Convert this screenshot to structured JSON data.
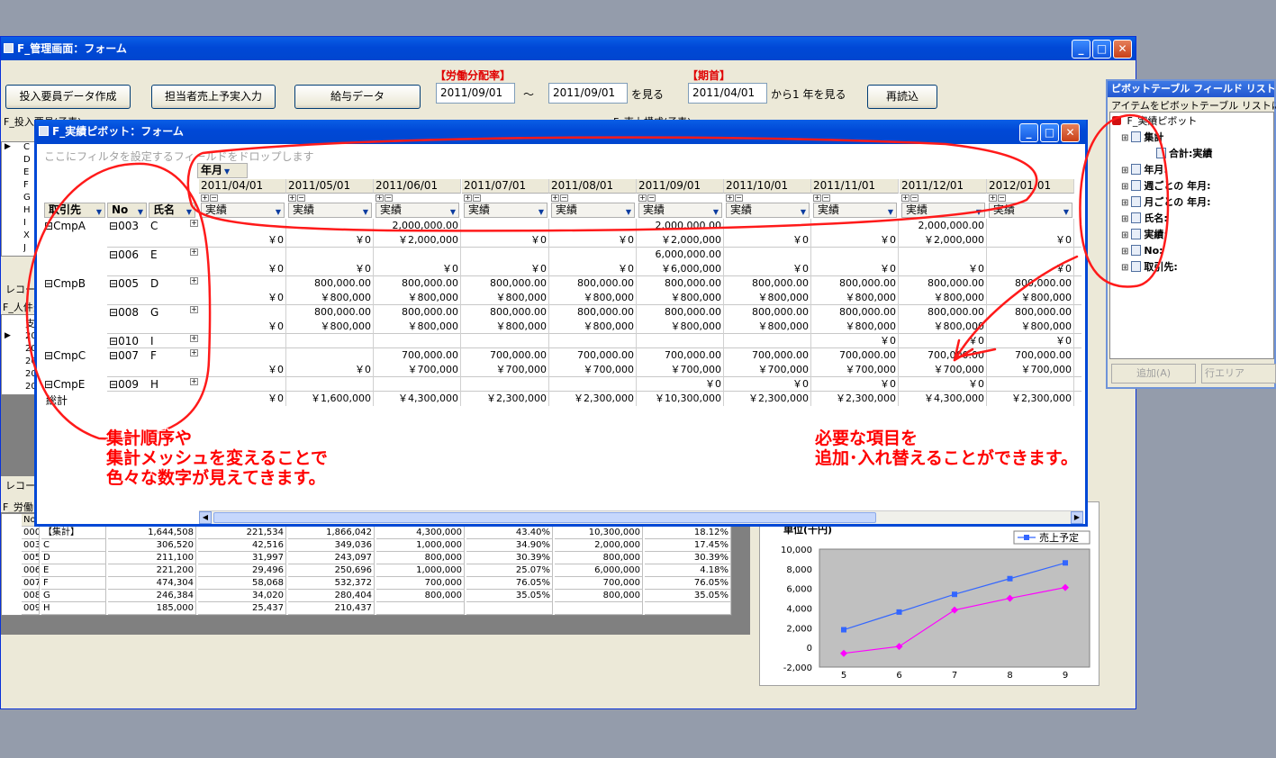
{
  "main_window": {
    "title": "F_管理画面：フォーム",
    "buttons": {
      "input_staff": "投入要員データ作成",
      "sales_plan": "担当者売上予実入力",
      "salary": "給与データ",
      "reload": "再読込"
    },
    "labor_rate_label": "【労働分配率】",
    "period_label": "【期首】",
    "date_from": "2011/09/01",
    "tilde": "～",
    "date_to": "2011/09/01",
    "view_label": "を見る",
    "period_start": "2011/04/01",
    "year_view_label": "から1 年を見る",
    "subform1_label": "F_投入要員(子表)",
    "subform2_label": "F_売上構成(子表)",
    "record_label": "レコー",
    "personnel_label": "F_人件費",
    "personnel_header": "支",
    "record_label2": "レコー",
    "labor_label": "F_労働",
    "left_rows": [
      "C",
      "D",
      "E",
      "F",
      "G",
      "H",
      "I",
      "X",
      "J"
    ],
    "personnel_rows": [
      "20",
      "20",
      "20",
      "20",
      "20"
    ]
  },
  "labor_table": {
    "header": "No",
    "rows": [
      [
        "000",
        "【集計】",
        "1,644,508",
        "221,534",
        "1,866,042",
        "4,300,000",
        "43.40%",
        "10,300,000",
        "18.12%"
      ],
      [
        "003",
        "C",
        "306,520",
        "42,516",
        "349,036",
        "1,000,000",
        "34.90%",
        "2,000,000",
        "17.45%"
      ],
      [
        "005",
        "D",
        "211,100",
        "31,997",
        "243,097",
        "800,000",
        "30.39%",
        "800,000",
        "30.39%"
      ],
      [
        "006",
        "E",
        "221,200",
        "29,496",
        "250,696",
        "1,000,000",
        "25.07%",
        "6,000,000",
        "4.18%"
      ],
      [
        "007",
        "F",
        "474,304",
        "58,068",
        "532,372",
        "700,000",
        "76.05%",
        "700,000",
        "76.05%"
      ],
      [
        "008",
        "G",
        "246,384",
        "34,020",
        "280,404",
        "800,000",
        "35.05%",
        "800,000",
        "35.05%"
      ],
      [
        "009",
        "H",
        "185,000",
        "25,437",
        "210,437",
        "",
        "",
        "",
        ""
      ]
    ]
  },
  "pivot_window": {
    "title": "F_実績ピボット：フォーム",
    "filter_hint": "ここにフィルタを設定するフィールドをドロップします",
    "col_field": "年月",
    "row_fields": [
      "取引先",
      "No",
      "氏名"
    ],
    "value_field": "実績",
    "months": [
      "2011/04/01",
      "2011/05/01",
      "2011/06/01",
      "2011/07/01",
      "2011/08/01",
      "2011/09/01",
      "2011/10/01",
      "2011/11/01",
      "2011/12/01",
      "2012/01/01"
    ],
    "row_labels": [
      {
        "client": "CmpA",
        "no": "003",
        "name": "C"
      },
      {
        "client": "",
        "no": "006",
        "name": "E"
      },
      {
        "client": "CmpB",
        "no": "005",
        "name": "D"
      },
      {
        "client": "",
        "no": "008",
        "name": "G"
      },
      {
        "client": "",
        "no": "010",
        "name": "I"
      },
      {
        "client": "CmpC",
        "no": "007",
        "name": "F"
      },
      {
        "client": "CmpE",
        "no": "009",
        "name": "H"
      }
    ],
    "grand_total_label": "総計",
    "rows": [
      [
        "",
        "",
        "2,000,000.00",
        "",
        "",
        "2,000,000.00",
        "",
        "",
        "2,000,000.00",
        ""
      ],
      [
        "￥0",
        "￥0",
        "￥2,000,000",
        "￥0",
        "￥0",
        "￥2,000,000",
        "￥0",
        "￥0",
        "￥2,000,000",
        "￥0"
      ],
      [
        "",
        "",
        "",
        "",
        "",
        "6,000,000.00",
        "",
        "",
        "",
        ""
      ],
      [
        "￥0",
        "￥0",
        "￥0",
        "￥0",
        "￥0",
        "￥6,000,000",
        "￥0",
        "￥0",
        "￥0",
        "￥0"
      ],
      [
        "",
        "800,000.00",
        "800,000.00",
        "800,000.00",
        "800,000.00",
        "800,000.00",
        "800,000.00",
        "800,000.00",
        "800,000.00",
        "800,000.00"
      ],
      [
        "￥0",
        "￥800,000",
        "￥800,000",
        "￥800,000",
        "￥800,000",
        "￥800,000",
        "￥800,000",
        "￥800,000",
        "￥800,000",
        "￥800,000"
      ],
      [
        "",
        "800,000.00",
        "800,000.00",
        "800,000.00",
        "800,000.00",
        "800,000.00",
        "800,000.00",
        "800,000.00",
        "800,000.00",
        "800,000.00"
      ],
      [
        "￥0",
        "￥800,000",
        "￥800,000",
        "￥800,000",
        "￥800,000",
        "￥800,000",
        "￥800,000",
        "￥800,000",
        "￥800,000",
        "￥800,000"
      ],
      [
        "",
        "",
        "",
        "",
        "",
        "",
        "",
        "￥0",
        "￥0",
        "￥0"
      ],
      [
        "",
        "",
        "700,000.00",
        "700,000.00",
        "700,000.00",
        "700,000.00",
        "700,000.00",
        "700,000.00",
        "700,000.00",
        "700,000.00"
      ],
      [
        "￥0",
        "￥0",
        "￥700,000",
        "￥700,000",
        "￥700,000",
        "￥700,000",
        "￥700,000",
        "￥700,000",
        "￥700,000",
        "￥700,000"
      ],
      [
        "",
        "",
        "",
        "",
        "",
        "￥0",
        "￥0",
        "￥0",
        "￥0",
        ""
      ],
      [
        "￥0",
        "￥1,600,000",
        "￥4,300,000",
        "￥2,300,000",
        "￥2,300,000",
        "￥10,300,000",
        "￥2,300,000",
        "￥2,300,000",
        "￥4,300,000",
        "￥2,300,000"
      ]
    ]
  },
  "field_list": {
    "title": "ピボットテーブル フィールド リスト",
    "hint": "アイテムをピボットテーブル リストにドラッ",
    "root": "F_実績ピボット",
    "items": [
      "集計",
      "合計:実績",
      "年月:",
      "週ごとの 年月:",
      "月ごとの 年月:",
      "氏名:",
      "実績:",
      "No:",
      "取引先:"
    ],
    "add_button": "追加(A)",
    "area_select": "行エリア"
  },
  "annotations": {
    "left": [
      "集計順序や",
      "集計メッシュを変えることで",
      "色々な数字が見えてきます。"
    ],
    "right": [
      "必要な項目を",
      "追加･入れ替えることができます。"
    ]
  },
  "chart_data": {
    "type": "line",
    "title": "単位(千円)",
    "x": [
      5,
      6,
      7,
      8,
      9
    ],
    "series": [
      {
        "name": "売上予定",
        "values": [
          1800,
          3600,
          5400,
          7000,
          8600
        ],
        "color": "#3366ff"
      },
      {
        "values": [
          -600,
          100,
          3800,
          5000,
          6100
        ],
        "color": "#ff00ff"
      }
    ],
    "ylim": [
      -2000,
      10000
    ],
    "yticks": [
      "10,000",
      "8,000",
      "6,000",
      "4,000",
      "2,000",
      "0",
      "-2,000"
    ],
    "xticks": [
      "5",
      "6",
      "7",
      "8",
      "9"
    ],
    "legend": "top-right",
    "grid": false
  },
  "colors": {
    "titlebar": "#0048d6",
    "annotation": "#ff0000",
    "pivot_header": "#ece9d8"
  }
}
